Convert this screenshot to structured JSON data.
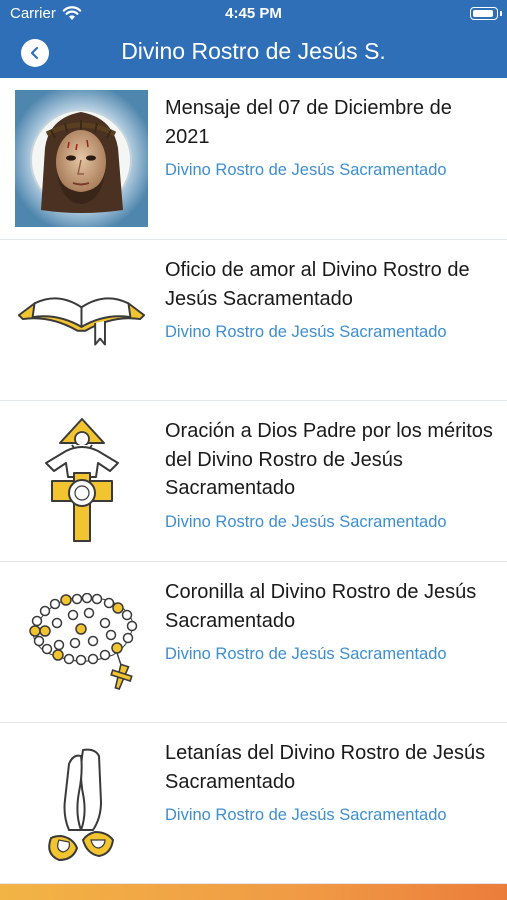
{
  "status_bar": {
    "carrier": "Carrier",
    "time": "4:45 PM"
  },
  "header": {
    "title": "Divino Rostro de Jesús S."
  },
  "items": [
    {
      "title": "Mensaje del 07 de Diciembre de 2021",
      "subtitle": "Divino Rostro de Jesús Sacramentado",
      "icon": "holy-face-image"
    },
    {
      "title": "Oficio de amor al Divino Rostro de Jesús Sacramentado",
      "subtitle": "Divino Rostro de Jesús Sacramentado",
      "icon": "open-book-icon"
    },
    {
      "title": "Oración a Dios Padre por los méritos del Divino Rostro de Jesús Sacramentado",
      "subtitle": "Divino Rostro de Jesús Sacramentado",
      "icon": "god-father-cross-icon"
    },
    {
      "title": "Coronilla al Divino Rostro de Jesús Sacramentado",
      "subtitle": "Divino Rostro de Jesús Sacramentado",
      "icon": "rosary-icon"
    },
    {
      "title": "Letanías del Divino Rostro de Jesús Sacramentado",
      "subtitle": "Divino Rostro de Jesús Sacramentado",
      "icon": "praying-hands-icon"
    }
  ],
  "colors": {
    "header_background": "#2f6fb8",
    "subtitle_text": "#3d8ed2",
    "icon_gold": "#f2c530",
    "footer_orange": "#eb7d3a"
  }
}
